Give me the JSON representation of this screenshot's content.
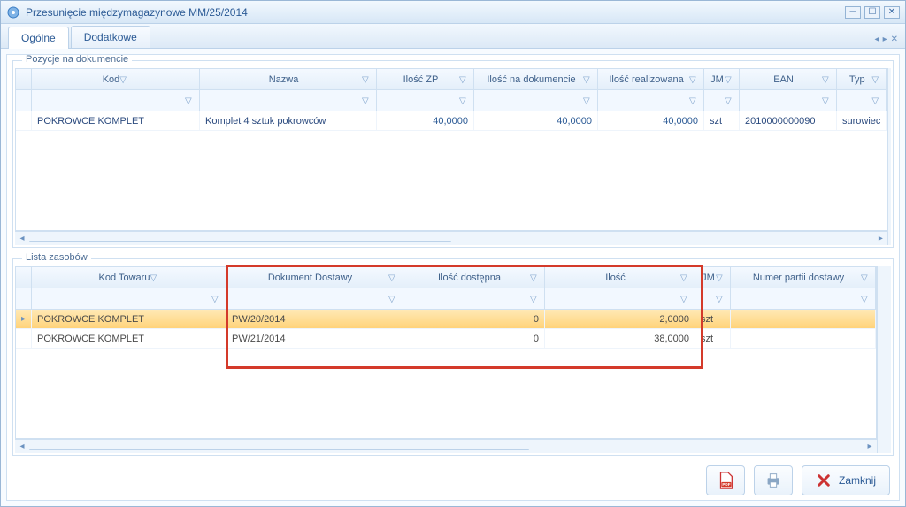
{
  "window": {
    "title": "Przesunięcie międzymagazynowe  MM/25/2014"
  },
  "tabs": [
    {
      "label": "Ogólne",
      "active": true
    },
    {
      "label": "Dodatkowe",
      "active": false
    }
  ],
  "positions": {
    "title": "Pozycje na dokumencie",
    "columns": [
      "Kod",
      "Nazwa",
      "Ilość ZP",
      "Ilość na dokumencie",
      "Ilość realizowana",
      "JM",
      "EAN",
      "Typ"
    ],
    "rows": [
      {
        "kod": "POKROWCE KOMPLET",
        "nazwa": "Komplet 4 sztuk pokrowców",
        "ilosc_zp": "40,0000",
        "ilosc_dok": "40,0000",
        "ilosc_real": "40,0000",
        "jm": "szt",
        "ean": "2010000000090",
        "typ": "surowiec"
      }
    ]
  },
  "resources": {
    "title": "Lista zasobów",
    "columns": [
      "Kod Towaru",
      "Dokument Dostawy",
      "Ilość dostępna",
      "Ilość",
      "JM",
      "Numer partii dostawy"
    ],
    "rows": [
      {
        "kod": "POKROWCE KOMPLET",
        "dok": "PW/20/2014",
        "dost": "0",
        "ilosc": "2,0000",
        "jm": "szt",
        "partia": ""
      },
      {
        "kod": "POKROWCE KOMPLET",
        "dok": "PW/21/2014",
        "dost": "0",
        "ilosc": "38,0000",
        "jm": "szt",
        "partia": ""
      }
    ],
    "highlighted_columns": [
      "Dokument Dostawy",
      "Ilość dostępna",
      "Ilość"
    ]
  },
  "footer": {
    "close_label": "Zamknij"
  },
  "colors": {
    "accent_border": "#9ab7d6",
    "link_text": "#2b5a95",
    "selected_row": "#ffd37a",
    "highlight_border": "#d43a2a"
  }
}
